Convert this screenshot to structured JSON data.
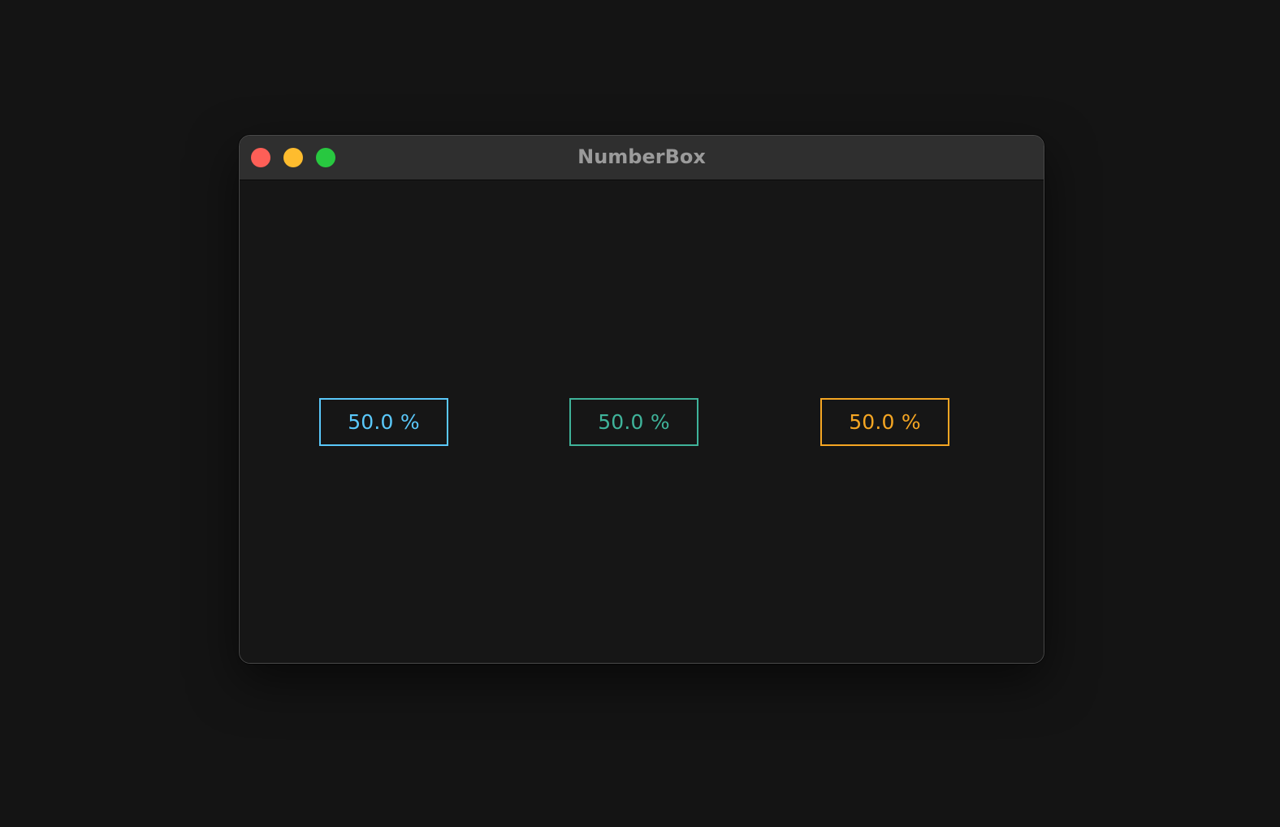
{
  "window": {
    "title": "NumberBox"
  },
  "colors": {
    "close": "#fe5f57",
    "minimize": "#febc2e",
    "zoom": "#28c840",
    "box1": "#5ac8fa",
    "box2": "#3fb39a",
    "box3": "#f5a623"
  },
  "number_boxes": [
    {
      "value": "50.0 %",
      "color": "#5ac8fa"
    },
    {
      "value": "50.0 %",
      "color": "#3fb39a"
    },
    {
      "value": "50.0 %",
      "color": "#f5a623"
    }
  ]
}
